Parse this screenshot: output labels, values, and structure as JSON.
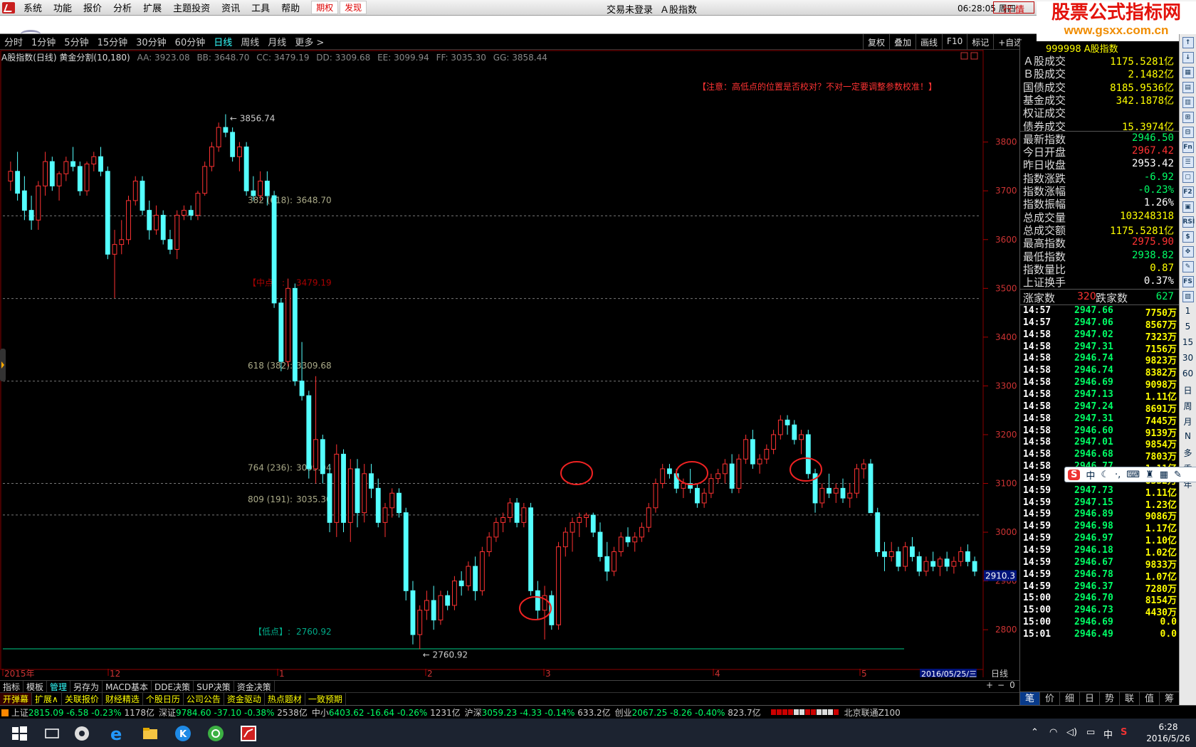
{
  "menubar": {
    "items": [
      "系统",
      "功能",
      "报价",
      "分析",
      "扩展",
      "主题投资",
      "资讯",
      "工具",
      "帮助"
    ],
    "red_items": [
      "期权",
      "发现"
    ],
    "login_status": "交易未登录",
    "index_name": "Ａ股指数",
    "clock": "06:28:05 周四",
    "quote_button": "行 情"
  },
  "brand": {
    "title": "股票公式指标网",
    "url": "www.gsxx.com.cn"
  },
  "period_bar": {
    "items": [
      "分时",
      "1分钟",
      "5分钟",
      "15分钟",
      "30分钟",
      "60分钟",
      "日线",
      "周线",
      "月线",
      "更多 >"
    ],
    "active": "日线",
    "tools": [
      "复权",
      "叠加",
      "画线",
      "F10",
      "标记",
      "+自选"
    ]
  },
  "chart_info": {
    "title": "A股指数(日线) 黄金分割(10,180)",
    "indicators": [
      "AA: 3923.08",
      "BB: 3648.70",
      "CC: 3479.19",
      "DD: 3309.68",
      "EE: 3099.94",
      "FF: 3035.30",
      "GG: 3858.44"
    ],
    "notice": "【注意：高低点的位置是否校对？不对一定要调整参数校准！】",
    "current_price_tag": "2910.3"
  },
  "chart_data": {
    "type": "candlestick",
    "y_axis": {
      "ticks": [
        2800,
        2900,
        3000,
        3100,
        3200,
        3300,
        3400,
        3500,
        3600,
        3700,
        3800
      ],
      "ylim": [
        2720,
        3960
      ]
    },
    "x_labels": [
      "2015年",
      "12",
      "1",
      "2",
      "3",
      "4",
      "5"
    ],
    "date_label": "2016/05/25/三",
    "high_marker": "3856.74",
    "low_marker": "2760.92",
    "fib_levels": [
      {
        "label": "382 (618):",
        "value": "3648.70",
        "price": 3648.7
      },
      {
        "label": "【中点】:",
        "value": "3479.19",
        "price": 3479.19
      },
      {
        "label": "618 (382):",
        "value": "3309.68",
        "price": 3309.68
      },
      {
        "label": "764 (236):",
        "value": "3099.94",
        "price": 3099.94
      },
      {
        "label": "809 (191):",
        "value": "3035.30",
        "price": 3035.3
      },
      {
        "label": "【低点】:",
        "value": "2760.92",
        "price": 2760.92
      }
    ],
    "candles": [
      [
        3720,
        3760,
        3700,
        3740
      ],
      [
        3740,
        3780,
        3680,
        3695
      ],
      [
        3700,
        3730,
        3640,
        3660
      ],
      [
        3660,
        3690,
        3620,
        3640
      ],
      [
        3640,
        3720,
        3620,
        3710
      ],
      [
        3710,
        3780,
        3690,
        3760
      ],
      [
        3760,
        3770,
        3700,
        3710
      ],
      [
        3710,
        3740,
        3680,
        3735
      ],
      [
        3735,
        3770,
        3720,
        3760
      ],
      [
        3760,
        3790,
        3740,
        3750
      ],
      [
        3750,
        3760,
        3690,
        3700
      ],
      [
        3700,
        3760,
        3690,
        3755
      ],
      [
        3755,
        3780,
        3740,
        3770
      ],
      [
        3770,
        3790,
        3730,
        3740
      ],
      [
        3740,
        3750,
        3560,
        3570
      ],
      [
        3570,
        3620,
        3480,
        3590
      ],
      [
        3590,
        3640,
        3570,
        3600
      ],
      [
        3600,
        3690,
        3590,
        3680
      ],
      [
        3680,
        3730,
        3670,
        3720
      ],
      [
        3720,
        3730,
        3650,
        3660
      ],
      [
        3660,
        3680,
        3600,
        3620
      ],
      [
        3620,
        3670,
        3610,
        3650
      ],
      [
        3650,
        3660,
        3590,
        3600
      ],
      [
        3600,
        3620,
        3570,
        3580
      ],
      [
        3580,
        3660,
        3560,
        3650
      ],
      [
        3650,
        3670,
        3640,
        3660
      ],
      [
        3660,
        3670,
        3640,
        3650
      ],
      [
        3650,
        3700,
        3640,
        3695
      ],
      [
        3695,
        3760,
        3690,
        3750
      ],
      [
        3750,
        3800,
        3740,
        3790
      ],
      [
        3790,
        3840,
        3780,
        3830
      ],
      [
        3830,
        3857,
        3810,
        3820
      ],
      [
        3820,
        3830,
        3760,
        3770
      ],
      [
        3770,
        3800,
        3740,
        3790
      ],
      [
        3790,
        3800,
        3690,
        3700
      ],
      [
        3700,
        3730,
        3680,
        3690
      ],
      [
        3690,
        3740,
        3680,
        3720
      ],
      [
        3720,
        3740,
        3670,
        3690
      ],
      [
        3690,
        3700,
        3460,
        3470
      ],
      [
        3470,
        3480,
        3330,
        3350
      ],
      [
        3350,
        3520,
        3340,
        3500
      ],
      [
        3500,
        3510,
        3300,
        3310
      ],
      [
        3310,
        3390,
        3270,
        3280
      ],
      [
        3280,
        3290,
        3110,
        3130
      ],
      [
        3130,
        3320,
        3100,
        3190
      ],
      [
        3190,
        3200,
        3100,
        3120
      ],
      [
        3120,
        3140,
        3000,
        3020
      ],
      [
        3020,
        3180,
        2990,
        3160
      ],
      [
        3160,
        3170,
        3000,
        3020
      ],
      [
        3020,
        3150,
        2980,
        3130
      ],
      [
        3130,
        3150,
        3010,
        3040
      ],
      [
        3040,
        3140,
        3020,
        3120
      ],
      [
        3120,
        3140,
        3070,
        3090
      ],
      [
        3090,
        3110,
        3010,
        3020
      ],
      [
        3020,
        3060,
        2990,
        3050
      ],
      [
        3050,
        3090,
        3030,
        3080
      ],
      [
        3080,
        3090,
        3030,
        3040
      ],
      [
        3040,
        3050,
        2860,
        2880
      ],
      [
        2880,
        2900,
        2770,
        2790
      ],
      [
        2790,
        2850,
        2760,
        2840
      ],
      [
        2840,
        2880,
        2820,
        2860
      ],
      [
        2860,
        2890,
        2800,
        2820
      ],
      [
        2820,
        2880,
        2810,
        2870
      ],
      [
        2870,
        2880,
        2840,
        2850
      ],
      [
        2850,
        2910,
        2840,
        2900
      ],
      [
        2900,
        2920,
        2870,
        2890
      ],
      [
        2890,
        2940,
        2880,
        2930
      ],
      [
        2930,
        2950,
        2860,
        2880
      ],
      [
        2880,
        2970,
        2870,
        2960
      ],
      [
        2960,
        3000,
        2950,
        2990
      ],
      [
        2990,
        3030,
        2980,
        3020
      ],
      [
        3020,
        3040,
        3000,
        3030
      ],
      [
        3030,
        3070,
        3020,
        3060
      ],
      [
        3060,
        3070,
        3010,
        3020
      ],
      [
        3020,
        3060,
        3010,
        3050
      ],
      [
        3050,
        3060,
        2870,
        2880
      ],
      [
        2880,
        2900,
        2820,
        2840
      ],
      [
        2840,
        2890,
        2780,
        2870
      ],
      [
        2870,
        2880,
        2800,
        2810
      ],
      [
        2810,
        2980,
        2800,
        2970
      ],
      [
        2970,
        3010,
        2950,
        3000
      ],
      [
        3000,
        3030,
        2960,
        3020
      ],
      [
        3020,
        3040,
        2990,
        3030
      ],
      [
        3030,
        3040,
        3010,
        3035
      ],
      [
        3035,
        3040,
        2990,
        3000
      ],
      [
        3000,
        3020,
        2940,
        2950
      ],
      [
        2950,
        2980,
        2900,
        2920
      ],
      [
        2920,
        2970,
        2910,
        2960
      ],
      [
        2960,
        3000,
        2950,
        2990
      ],
      [
        2990,
        3010,
        2970,
        2980
      ],
      [
        2980,
        3000,
        2960,
        2990
      ],
      [
        2990,
        3020,
        2980,
        3010
      ],
      [
        3010,
        3060,
        3000,
        3050
      ],
      [
        3050,
        3110,
        3040,
        3100
      ],
      [
        3100,
        3140,
        3090,
        3130
      ],
      [
        3130,
        3140,
        3110,
        3120
      ],
      [
        3120,
        3130,
        3080,
        3090
      ],
      [
        3090,
        3110,
        3070,
        3100
      ],
      [
        3100,
        3130,
        3080,
        3090
      ],
      [
        3090,
        3100,
        3050,
        3060
      ],
      [
        3060,
        3090,
        3050,
        3080
      ],
      [
        3080,
        3120,
        3070,
        3110
      ],
      [
        3110,
        3130,
        3100,
        3120
      ],
      [
        3120,
        3150,
        3100,
        3140
      ],
      [
        3140,
        3160,
        3080,
        3090
      ],
      [
        3090,
        3160,
        3080,
        3150
      ],
      [
        3150,
        3200,
        3140,
        3190
      ],
      [
        3190,
        3210,
        3130,
        3140
      ],
      [
        3140,
        3160,
        3120,
        3150
      ],
      [
        3150,
        3180,
        3140,
        3170
      ],
      [
        3170,
        3210,
        3160,
        3200
      ],
      [
        3200,
        3240,
        3190,
        3230
      ],
      [
        3230,
        3240,
        3200,
        3220
      ],
      [
        3220,
        3230,
        3180,
        3190
      ],
      [
        3190,
        3210,
        3160,
        3200
      ],
      [
        3200,
        3210,
        3110,
        3120
      ],
      [
        3120,
        3130,
        3040,
        3060
      ],
      [
        3060,
        3100,
        3050,
        3090
      ],
      [
        3090,
        3120,
        3070,
        3080
      ],
      [
        3080,
        3100,
        3060,
        3090
      ],
      [
        3090,
        3110,
        3060,
        3070
      ],
      [
        3070,
        3100,
        3050,
        3080
      ],
      [
        3080,
        3140,
        3070,
        3130
      ],
      [
        3130,
        3150,
        3110,
        3140
      ],
      [
        3140,
        3150,
        3050,
        3040
      ],
      [
        3040,
        3050,
        2950,
        2960
      ],
      [
        2960,
        2980,
        2920,
        2950
      ],
      [
        2950,
        2980,
        2940,
        2960
      ],
      [
        2960,
        2970,
        2920,
        2930
      ],
      [
        2930,
        2980,
        2920,
        2970
      ],
      [
        2970,
        2990,
        2940,
        2950
      ],
      [
        2950,
        2960,
        2910,
        2920
      ],
      [
        2920,
        2950,
        2910,
        2940
      ],
      [
        2940,
        2960,
        2920,
        2930
      ],
      [
        2930,
        2950,
        2910,
        2945
      ],
      [
        2945,
        2960,
        2920,
        2930
      ],
      [
        2930,
        2950,
        2915,
        2940
      ],
      [
        2940,
        2970,
        2930,
        2960
      ],
      [
        2960,
        2975,
        2930,
        2940
      ],
      [
        2940,
        2950,
        2910,
        2920
      ]
    ]
  },
  "right_panel": {
    "header": "999998 A股指数",
    "rows": [
      {
        "k": "Ａ股成交",
        "v": "1175.5281亿",
        "c": "#ff0"
      },
      {
        "k": "Ｂ股成交",
        "v": "2.1482亿",
        "c": "#ff0"
      },
      {
        "k": "国债成交",
        "v": "8185.9536亿",
        "c": "#ff0"
      },
      {
        "k": "基金成交",
        "v": "342.1878亿",
        "c": "#ff0"
      },
      {
        "k": "权证成交",
        "v": "",
        "c": "#ff0"
      },
      {
        "k": "债券成交",
        "v": "15.3974亿",
        "c": "#ff0"
      },
      {
        "k": "最新指数",
        "v": "2946.50",
        "c": "#0f6"
      },
      {
        "k": "今日开盘",
        "v": "2967.42",
        "c": "#f33"
      },
      {
        "k": "昨日收盘",
        "v": "2953.42",
        "c": "#fff"
      },
      {
        "k": "指数涨跌",
        "v": "-6.92",
        "c": "#0f6"
      },
      {
        "k": "指数涨幅",
        "v": "-0.23%",
        "c": "#0f6"
      },
      {
        "k": "指数振幅",
        "v": "1.26%",
        "c": "#fff"
      },
      {
        "k": "总成交量",
        "v": "103248318",
        "c": "#ff0"
      },
      {
        "k": "总成交额",
        "v": "1175.5281亿",
        "c": "#ff0"
      },
      {
        "k": "最高指数",
        "v": "2975.90",
        "c": "#f33"
      },
      {
        "k": "最低指数",
        "v": "2938.82",
        "c": "#0f6"
      },
      {
        "k": "指数量比",
        "v": "0.87",
        "c": "#ff0"
      },
      {
        "k": "上证换手",
        "v": "0.37%",
        "c": "#fff"
      }
    ],
    "up_down": {
      "up_label": "涨家数",
      "up": "320",
      "down_label": "跌家数",
      "down": "627"
    },
    "ticks": [
      [
        "14:57",
        "2947.66",
        "7750万"
      ],
      [
        "14:57",
        "2947.06",
        "8567万"
      ],
      [
        "14:58",
        "2947.02",
        "7323万"
      ],
      [
        "14:58",
        "2947.31",
        "7156万"
      ],
      [
        "14:58",
        "2946.74",
        "9823万"
      ],
      [
        "14:58",
        "2946.74",
        "8382万"
      ],
      [
        "14:58",
        "2946.69",
        "9098万"
      ],
      [
        "14:58",
        "2947.13",
        "1.11亿"
      ],
      [
        "14:58",
        "2947.24",
        "8691万"
      ],
      [
        "14:58",
        "2947.31",
        "7445万"
      ],
      [
        "14:58",
        "2946.60",
        "9139万"
      ],
      [
        "14:58",
        "2947.01",
        "9854万"
      ],
      [
        "14:58",
        "2946.68",
        "7803万"
      ],
      [
        "14:58",
        "2946.77",
        "1.11亿"
      ],
      [
        "14:59",
        "2947.37",
        "8332万"
      ],
      [
        "14:59",
        "2947.73",
        "1.11亿"
      ],
      [
        "14:59",
        "2947.15",
        "1.23亿"
      ],
      [
        "14:59",
        "2946.89",
        "9086万"
      ],
      [
        "14:59",
        "2946.98",
        "1.17亿"
      ],
      [
        "14:59",
        "2946.97",
        "1.10亿"
      ],
      [
        "14:59",
        "2946.18",
        "1.02亿"
      ],
      [
        "14:59",
        "2946.67",
        "9833万"
      ],
      [
        "14:59",
        "2946.78",
        "1.07亿"
      ],
      [
        "14:59",
        "2946.37",
        "7280万"
      ],
      [
        "15:00",
        "2946.70",
        "8154万"
      ],
      [
        "15:00",
        "2946.73",
        "4430万"
      ],
      [
        "15:00",
        "2946.69",
        "0.0"
      ],
      [
        "15:01",
        "2946.49",
        "0.0"
      ]
    ],
    "tabs": [
      "笔",
      "价",
      "细",
      "日",
      "势",
      "联",
      "值",
      "筹"
    ]
  },
  "icon_strip": [
    "↑",
    "↓",
    "▦",
    "▤",
    "▥",
    "⊞",
    "⊟",
    "Fn",
    "☰",
    "▢",
    "F2",
    "▣",
    "RSI",
    "$",
    "✥",
    "✎",
    "FS",
    "▨",
    "1",
    "5",
    "15",
    "30",
    "60",
    "日",
    "周",
    "月",
    "N",
    "多",
    "季",
    "年"
  ],
  "bottom_tabs1": [
    "指标",
    "模板",
    "管理",
    "另存为",
    "MACD基本",
    "DDE决策",
    "SUP决策",
    "资金决策"
  ],
  "bottom_tabs2": [
    "开弹幕",
    "扩展∧",
    "关联报价",
    "财经精选",
    "个股日历",
    "公司公告",
    "资金驱动",
    "热点题材",
    "一致预期"
  ],
  "period_label": "日线",
  "status": {
    "sh": {
      "name": "上证",
      "v": "2815.09",
      "chg": "-6.58",
      "pct": "-0.23%",
      "amt": "1178亿"
    },
    "sz": {
      "name": "深证",
      "v": "9784.60",
      "chg": "-37.10",
      "pct": "-0.38%",
      "amt": "2538亿"
    },
    "zx": {
      "name": "中小",
      "v": "6403.62",
      "chg": "-16.64",
      "pct": "-0.26%",
      "amt": "1231亿"
    },
    "hs": {
      "name": "沪深",
      "v": "3059.23",
      "chg": "-4.33",
      "pct": "-0.14%",
      "amt": "633.2亿"
    },
    "cy": {
      "name": "创业",
      "v": "2067.25",
      "chg": "-8.26",
      "pct": "-0.40%",
      "amt": "823.7亿"
    },
    "broker": "北京联通Z100"
  },
  "taskbar": {
    "time": "6:28",
    "date": "2016/5/26",
    "ime": "中"
  }
}
